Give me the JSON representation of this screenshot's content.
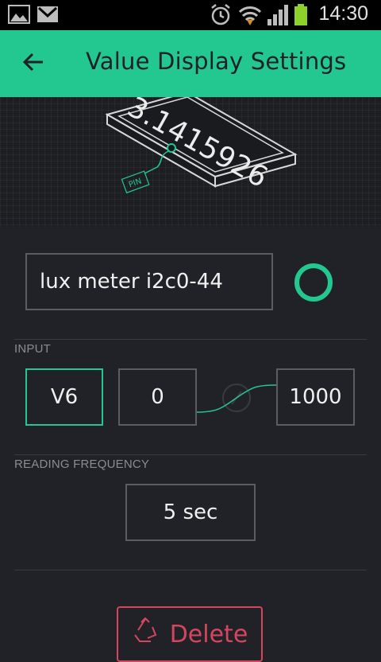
{
  "status_bar": {
    "time": "14:30",
    "icons": [
      "gallery-icon",
      "gmail-icon",
      "alarm-icon",
      "wifi-icon",
      "signal-icon",
      "battery-icon"
    ]
  },
  "header": {
    "title": "Value Display Settings",
    "back_icon": "arrow-back-icon"
  },
  "hero": {
    "display_value": "3.1415926",
    "pin_label": "PIN"
  },
  "name_field": {
    "value": "lux meter i2c0-44",
    "color_accent": "#23c890"
  },
  "input_section": {
    "label": "INPUT",
    "pin": "V6",
    "min": "0",
    "max": "1000"
  },
  "frequency_section": {
    "label": "READING FREQUENCY",
    "value": "5 sec"
  },
  "delete": {
    "label": "Delete",
    "color": "#d4465f"
  },
  "colors": {
    "accent": "#23c890",
    "background": "#212227",
    "danger": "#d4465f"
  }
}
